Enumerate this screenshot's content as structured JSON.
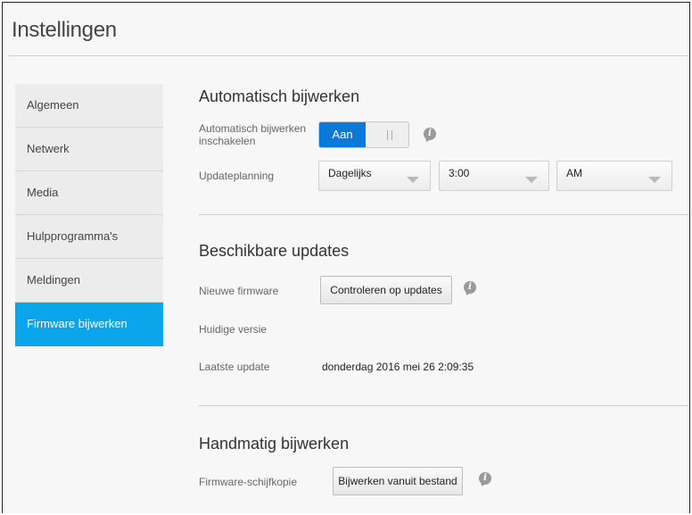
{
  "header": {
    "title": "Instellingen"
  },
  "sidebar": {
    "items": [
      {
        "label": "Algemeen"
      },
      {
        "label": "Netwerk"
      },
      {
        "label": "Media"
      },
      {
        "label": "Hulpprogramma's"
      },
      {
        "label": "Meldingen"
      },
      {
        "label": "Firmware bijwerken",
        "active": true
      }
    ]
  },
  "auto_update": {
    "title": "Automatisch bijwerken",
    "enable_label_line1": "Automatisch bijwerken",
    "enable_label_line2": "inschakelen",
    "toggle_on_label": "Aan",
    "schedule_label": "Updateplanning",
    "frequency": "Dagelijks",
    "time": "3:00",
    "meridiem": "AM"
  },
  "available_updates": {
    "title": "Beschikbare updates",
    "new_firmware_label": "Nieuwe firmware",
    "check_button": "Controleren op updates",
    "current_version_label": "Huidige versie",
    "last_update_label": "Laatste update",
    "last_update_value": "donderdag 2016 mei 26 2:09:35"
  },
  "manual_update": {
    "title": "Handmatig bijwerken",
    "image_label": "Firmware-schijfkopie",
    "update_file_button": "Bijwerken vanuit bestand"
  },
  "colors": {
    "accent": "#0ba5ec",
    "toggle_on": "#0a7ad6"
  },
  "icons": {
    "info": "info-icon",
    "dropdown": "chevron-down-icon"
  }
}
